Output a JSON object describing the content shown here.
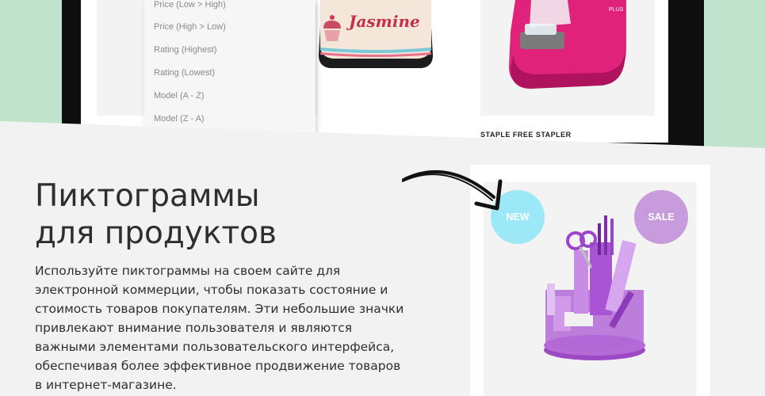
{
  "colors": {
    "mint_background": "#bfe3cc",
    "monitor_bezel": "#0e0e0e",
    "badge_new": "#9de8f7",
    "badge_sale": "#c79bdc",
    "text": "#2e2e2e"
  },
  "sort_dropdown": {
    "items": [
      "Price (Low > High)",
      "Price (High > Low)",
      "Rating (Highest)",
      "Rating (Lowest)",
      "Model (A - Z)",
      "Model (Z - A)"
    ]
  },
  "products": {
    "bag_brand_text": "Jasmine",
    "stapler_name": "STAPLE FREE STAPLER",
    "stapler_brand_text": "PLUS"
  },
  "feature": {
    "title_line1": "Пиктограммы",
    "title_line2": "для продуктов",
    "description": "Используйте пиктограммы на своем сайте для электронной коммерции, чтобы показать состояние и стоимость товаров покупателям. Эти небольшие значки привлекают внимание пользователя и являются важными элементами пользовательского интерфейса, обеспечивая более эффективное продвижение товаров в интернет-магазине."
  },
  "badges": {
    "new_label": "NEW",
    "sale_label": "SALE"
  },
  "icons": {
    "arrow": "curved-arrow-icon"
  }
}
